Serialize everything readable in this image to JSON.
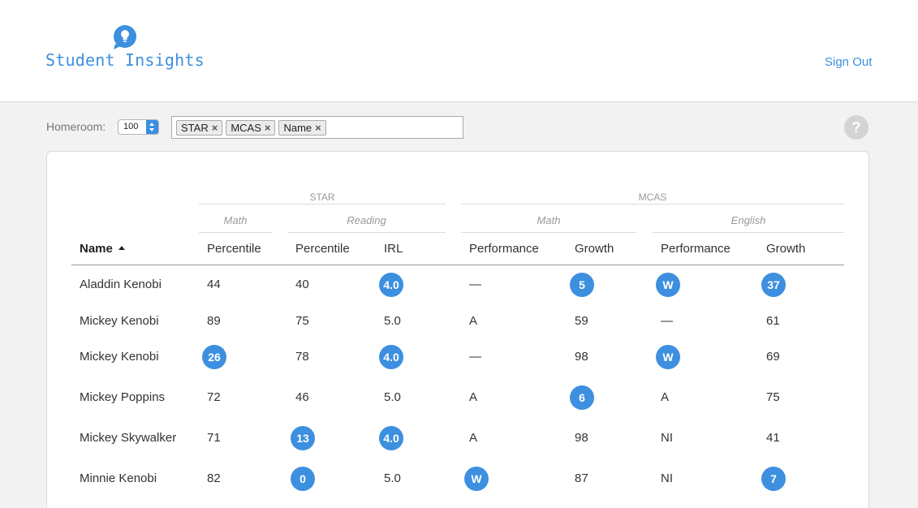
{
  "app": {
    "title": "Student Insights",
    "sign_out": "Sign Out"
  },
  "controls": {
    "homeroom_label": "Homeroom:",
    "homeroom_value": "100",
    "filters": [
      "STAR",
      "MCAS",
      "Name"
    ],
    "chip_remove": "×",
    "help": "?"
  },
  "table": {
    "groups": {
      "star": "STAR",
      "mcas": "MCAS"
    },
    "subgroups": {
      "star_math": "Math",
      "star_reading": "Reading",
      "mcas_math": "Math",
      "mcas_english": "English"
    },
    "columns": [
      "Name",
      "Percentile",
      "Percentile",
      "IRL",
      "Performance",
      "Growth",
      "Performance",
      "Growth"
    ],
    "rows": [
      {
        "name": "Aladdin Kenobi",
        "cells": [
          {
            "v": "44"
          },
          {
            "v": "40"
          },
          {
            "v": "4.0",
            "hl": true
          },
          {
            "v": "—"
          },
          {
            "v": "5",
            "hl": true
          },
          {
            "v": "W",
            "hl": true
          },
          {
            "v": "37",
            "hl": true
          }
        ]
      },
      {
        "name": "Mickey Kenobi",
        "cells": [
          {
            "v": "89"
          },
          {
            "v": "75"
          },
          {
            "v": "5.0"
          },
          {
            "v": "A"
          },
          {
            "v": "59"
          },
          {
            "v": "—"
          },
          {
            "v": "61"
          }
        ]
      },
      {
        "name": "Mickey Kenobi",
        "cells": [
          {
            "v": "26",
            "hl": true
          },
          {
            "v": "78"
          },
          {
            "v": "4.0",
            "hl": true
          },
          {
            "v": "—"
          },
          {
            "v": "98"
          },
          {
            "v": "W",
            "hl": true
          },
          {
            "v": "69"
          }
        ]
      },
      {
        "name": "Mickey Poppins",
        "cells": [
          {
            "v": "72"
          },
          {
            "v": "46"
          },
          {
            "v": "5.0"
          },
          {
            "v": "A"
          },
          {
            "v": "6",
            "hl": true
          },
          {
            "v": "A"
          },
          {
            "v": "75"
          }
        ]
      },
      {
        "name": "Mickey Skywalker",
        "cells": [
          {
            "v": "71"
          },
          {
            "v": "13",
            "hl": true
          },
          {
            "v": "4.0",
            "hl": true
          },
          {
            "v": "A"
          },
          {
            "v": "98"
          },
          {
            "v": "NI"
          },
          {
            "v": "41"
          }
        ]
      },
      {
        "name": "Minnie Kenobi",
        "cells": [
          {
            "v": "82"
          },
          {
            "v": "0",
            "hl": true
          },
          {
            "v": "5.0"
          },
          {
            "v": "W",
            "hl": true
          },
          {
            "v": "87"
          },
          {
            "v": "NI"
          },
          {
            "v": "7",
            "hl": true
          }
        ]
      }
    ]
  },
  "colors": {
    "accent": "#3d8fdf",
    "highlight_badge": "#3d8fdf"
  }
}
